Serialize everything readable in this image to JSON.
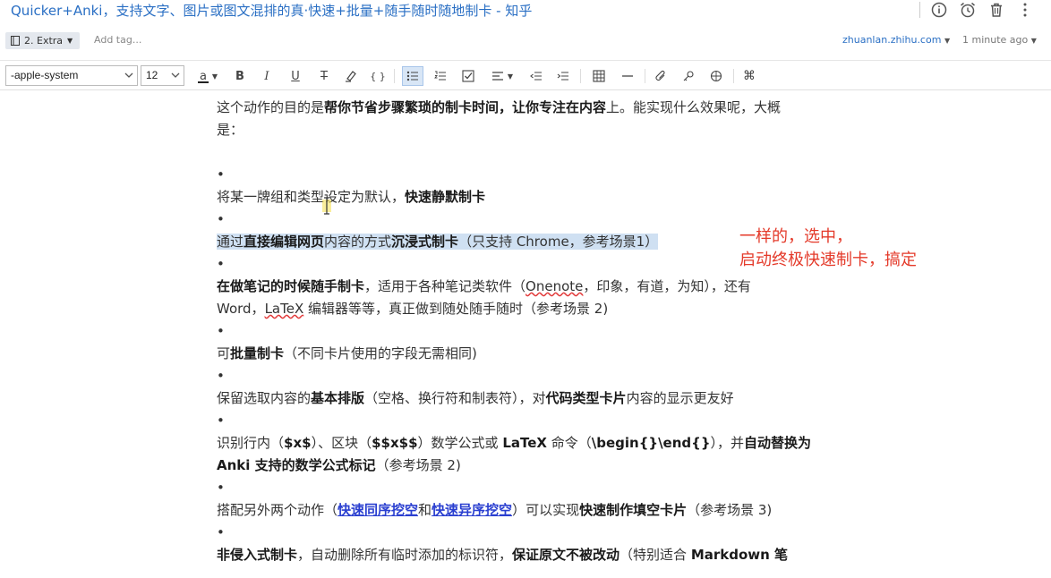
{
  "window": {
    "title": "Quicker+Anki，支持文字、图片或图文混排的真·快速+批量+随手随时随地制卡 - 知乎",
    "icons": [
      "info-icon",
      "alarm-icon",
      "trash-icon",
      "more-icon"
    ]
  },
  "meta": {
    "notebook": "2. Extra",
    "add_tag": "Add tag...",
    "source": "zhuanlan.zhihu.com",
    "time": "1 minute ago"
  },
  "toolbar": {
    "font_family": "-apple-system",
    "font_size": "12",
    "text_color_label": "a"
  },
  "content": {
    "intro_1a": "这个动作的目的是",
    "intro_1b": "帮你节省步骤繁琐的制卡时间，让你专注在内容",
    "intro_1c": "上。能实现什么效果呢，大概",
    "intro_2": "是：",
    "bullet": "•",
    "i1a": "将某一牌组和类型设定为默认，",
    "i1b": "快速静默制卡",
    "i2a": "通过",
    "i2b": "直接编辑网页",
    "i2c": "内容的方式",
    "i2d": "沉浸式制卡",
    "i2e": "（只支持 Chrome，参考场景1）",
    "i3a": "在做笔记的时候随手制卡",
    "i3b": "，适用于各种笔记类软件（",
    "i3c": "Onenote",
    "i3d": "，印象，有道，为知），还有",
    "i3e": "Word，",
    "i3f": "LaTeX",
    "i3g": " 编辑器等等，真正做到随处随手随时（参考场景 2)",
    "i4a": "可",
    "i4b": "批量制卡",
    "i4c": "（不同卡片使用的字段无需相同)",
    "i5a": "保留选取内容的",
    "i5b": "基本排版",
    "i5c": "（空格、换行符和制表符），对",
    "i5d": "代码类型卡片",
    "i5e": "内容的显示更友好",
    "i6a": "识别行内（",
    "i6b": "$x$",
    "i6c": "）、区块（",
    "i6d": "$$x$$",
    "i6e": "）数学公式或 ",
    "i6f": "LaTeX",
    "i6g": " 命令（",
    "i6h": "\\begin{}\\end{}",
    "i6i": "），并",
    "i6j": "自动替换为",
    "i6k": "Anki 支持的数学公式标记",
    "i6l": "（参考场景 2)",
    "i7a": "搭配另外两个动作（",
    "i7b": "快速同序挖空",
    "i7c": "和",
    "i7d": "快速异序挖空",
    "i7e": "）可以实现",
    "i7f": "快速制作填空卡片",
    "i7g": "（参考场景 3)",
    "i8a": "非侵入式制卡",
    "i8b": "，自动删除所有临时添加的标识符，",
    "i8c": "保证原文不被改动",
    "i8d": "（特别适合 ",
    "i8e": "Markdown 笔"
  },
  "annotation": {
    "line1": "一样的，选中，",
    "line2": "启动终极快速制卡，搞定"
  },
  "colors": {
    "title": "#2a6fc4",
    "annotation": "#e43a2a",
    "highlight": "#cfe0f2",
    "link": "#2a3fd0"
  }
}
